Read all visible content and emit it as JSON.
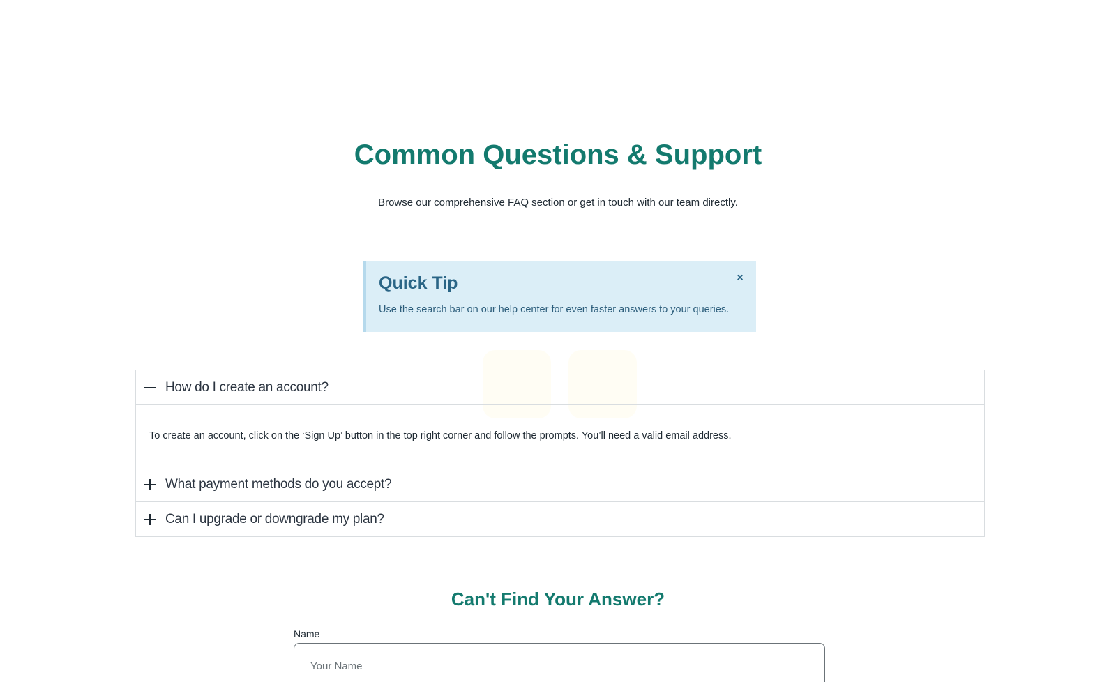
{
  "header": {
    "title": "Common Questions & Support",
    "subtitle": "Browse our comprehensive FAQ section or get in touch with our team directly."
  },
  "tip": {
    "title": "Quick Tip",
    "text": "Use the search bar on our help center for even faster answers to your queries.",
    "close_label": "×"
  },
  "faq": {
    "items": [
      {
        "question": "How do I create an account?",
        "answer": "To create an account, click on the ‘Sign Up’ button in the top right corner and follow the prompts. You’ll need a valid email address.",
        "expanded": true,
        "icon": "minus-icon"
      },
      {
        "question": "What payment methods do you accept?",
        "expanded": false,
        "icon": "plus-icon"
      },
      {
        "question": "Can I upgrade or downgrade my plan?",
        "expanded": false,
        "icon": "plus-icon"
      }
    ]
  },
  "contact": {
    "title": "Can't Find Your Answer?",
    "name_label": "Name",
    "name_placeholder": "Your Name"
  },
  "colors": {
    "accent": "#137a6e",
    "tip_bg": "#dbeef7",
    "tip_text": "#2a6586",
    "border": "#d9dde0"
  }
}
